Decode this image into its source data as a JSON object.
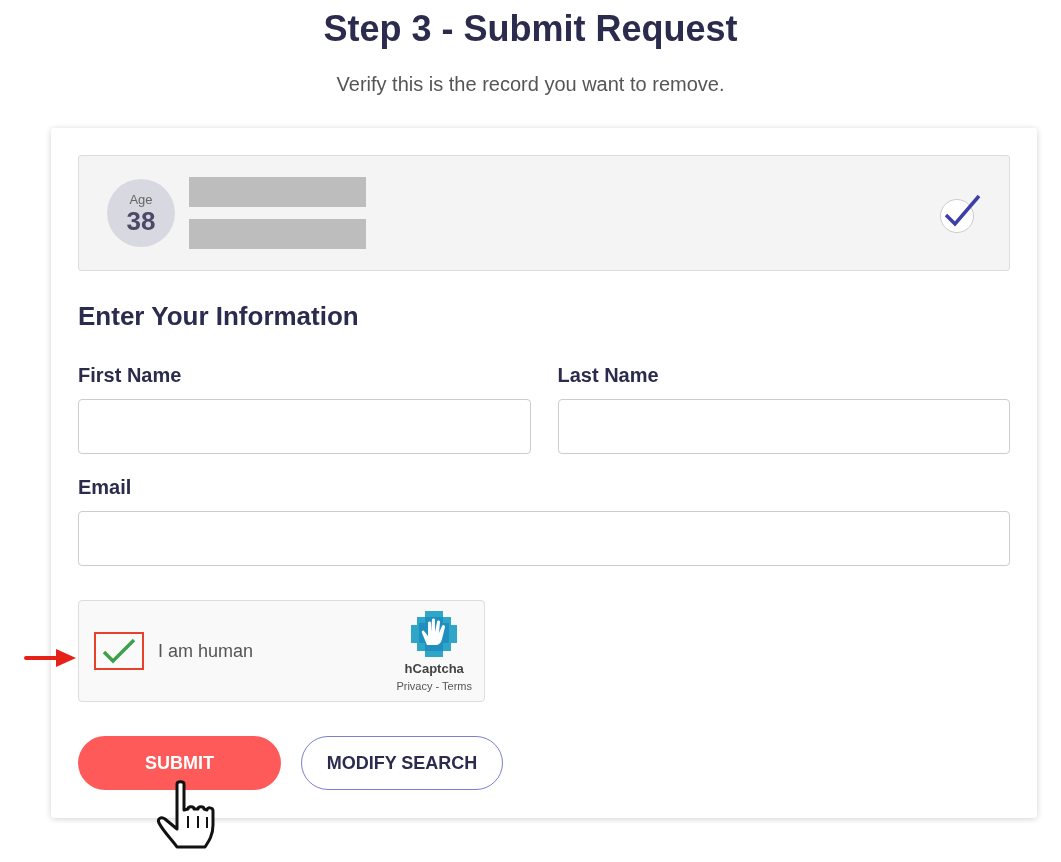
{
  "header": {
    "title": "Step 3 - Submit Request",
    "subtitle": "Verify this is the record you want to remove."
  },
  "record": {
    "age_label": "Age",
    "age": "38",
    "selected": true
  },
  "form": {
    "heading": "Enter Your Information",
    "fields": [
      {
        "label": "First Name"
      },
      {
        "label": "Last Name"
      },
      {
        "label": "Email"
      }
    ]
  },
  "captcha": {
    "label": "I am human",
    "checked": true,
    "brand": "hCaptcha",
    "links": "Privacy - Terms"
  },
  "buttons": [
    {
      "label": "SUBMIT",
      "kind": "primary"
    },
    {
      "label": "MODIFY SEARCH",
      "kind": "outline"
    }
  ]
}
